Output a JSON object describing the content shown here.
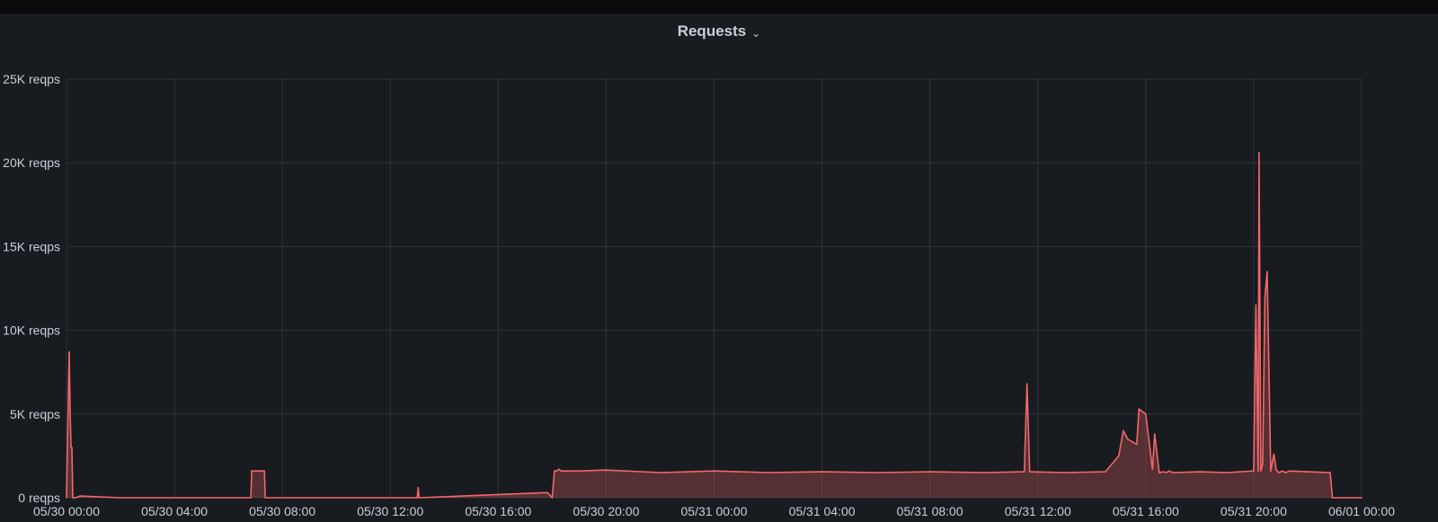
{
  "panel": {
    "title": "Requests"
  },
  "colors": {
    "background": "#181b1f",
    "grid": "#2f3238",
    "series": "#f2676a",
    "series_fill": "rgba(242,103,106,0.28)",
    "text": "#ccccdc"
  },
  "chart_data": {
    "type": "area",
    "title": "Requests",
    "grid": true,
    "legend": "none",
    "ylim": [
      0,
      25000
    ],
    "y_unit": "reqps",
    "y_ticks": [
      {
        "value": 0,
        "label": "0 reqps"
      },
      {
        "value": 5000,
        "label": "5K reqps"
      },
      {
        "value": 10000,
        "label": "10K reqps"
      },
      {
        "value": 15000,
        "label": "15K reqps"
      },
      {
        "value": 20000,
        "label": "20K reqps"
      },
      {
        "value": 25000,
        "label": "25K reqps"
      }
    ],
    "xlim": [
      "05/30 00:00",
      "06/01 00:00"
    ],
    "x_ticks": [
      {
        "value": "05/30 00:00",
        "label": "05/30 00:00"
      },
      {
        "value": "05/30 04:00",
        "label": "05/30 04:00"
      },
      {
        "value": "05/30 08:00",
        "label": "05/30 08:00"
      },
      {
        "value": "05/30 12:00",
        "label": "05/30 12:00"
      },
      {
        "value": "05/30 16:00",
        "label": "05/30 16:00"
      },
      {
        "value": "05/30 20:00",
        "label": "05/30 20:00"
      },
      {
        "value": "05/31 00:00",
        "label": "05/31 00:00"
      },
      {
        "value": "05/31 04:00",
        "label": "05/31 04:00"
      },
      {
        "value": "05/31 08:00",
        "label": "05/31 08:00"
      },
      {
        "value": "05/31 12:00",
        "label": "05/31 12:00"
      },
      {
        "value": "05/31 16:00",
        "label": "05/31 16:00"
      },
      {
        "value": "05/31 20:00",
        "label": "05/31 20:00"
      },
      {
        "value": "06/01 00:00",
        "label": "06/01 00:00"
      }
    ],
    "series": [
      {
        "x": [
          "05/30 00:00",
          "05/30 00:06",
          "05/30 00:08",
          "05/30 00:10",
          "05/30 00:12",
          "05/30 00:14",
          "05/30 00:16",
          "05/30 00:20",
          "05/30 00:30",
          "05/30 02:00",
          "05/30 06:50",
          "05/30 06:52",
          "05/30 07:20",
          "05/30 07:22",
          "05/30 13:00",
          "05/30 13:02",
          "05/30 13:04",
          "05/30 17:40",
          "05/30 17:50",
          "05/30 18:00",
          "05/30 18:05",
          "05/30 18:10",
          "05/30 18:15",
          "05/30 18:20",
          "05/30 19:00",
          "05/30 20:00",
          "05/30 22:00",
          "05/31 00:00",
          "05/31 02:00",
          "05/31 04:00",
          "05/31 06:00",
          "05/31 08:00",
          "05/31 10:00",
          "05/31 11:30",
          "05/31 11:36",
          "05/31 11:42",
          "05/31 13:00",
          "05/31 14:30",
          "05/31 15:00",
          "05/31 15:10",
          "05/31 15:20",
          "05/31 15:40",
          "05/31 15:45",
          "05/31 16:00",
          "05/31 16:15",
          "05/31 16:20",
          "05/31 16:30",
          "05/31 16:40",
          "05/31 16:46",
          "05/31 16:52",
          "05/31 17:00",
          "05/31 18:00",
          "05/31 19:00",
          "05/31 20:00",
          "05/31 20:05",
          "05/31 20:10",
          "05/31 20:12",
          "05/31 20:16",
          "05/31 20:20",
          "05/31 20:25",
          "05/31 20:30",
          "05/31 20:38",
          "05/31 20:45",
          "05/31 20:50",
          "05/31 20:55",
          "05/31 21:00",
          "05/31 21:05",
          "05/31 21:10",
          "05/31 21:20",
          "05/31 22:00",
          "05/31 22:50",
          "05/31 22:55",
          "05/31 23:30",
          "06/01 00:00"
        ],
        "y": [
          0,
          8700,
          5300,
          3000,
          3000,
          0,
          0,
          0,
          100,
          0,
          0,
          1600,
          1600,
          0,
          0,
          600,
          0,
          300,
          300,
          0,
          1600,
          1600,
          1700,
          1600,
          1600,
          1650,
          1500,
          1600,
          1500,
          1550,
          1500,
          1550,
          1500,
          1550,
          6800,
          1550,
          1500,
          1550,
          2500,
          4000,
          3500,
          3200,
          5300,
          5000,
          1700,
          3800,
          1500,
          1550,
          1500,
          1600,
          1500,
          1550,
          1500,
          1600,
          11500,
          1600,
          20600,
          1600,
          2000,
          12000,
          13500,
          1600,
          2600,
          1700,
          1500,
          1550,
          1600,
          1500,
          1600,
          1550,
          1500,
          0,
          0,
          0
        ]
      }
    ]
  }
}
